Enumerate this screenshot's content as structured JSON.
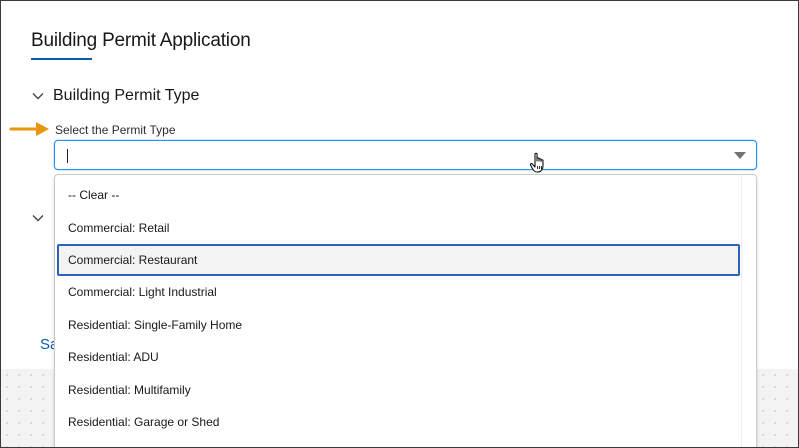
{
  "app": {
    "title": "Building Permit Application"
  },
  "sections": [
    {
      "label": "Building Permit Type",
      "expanded": true
    },
    {
      "label": "",
      "expanded": false
    }
  ],
  "field": {
    "label": "Select the Permit Type",
    "value": "",
    "placeholder": ""
  },
  "dropdown": {
    "options": [
      "-- Clear --",
      "Commercial: Retail",
      "Commercial: Restaurant",
      "Commercial: Light Industrial",
      "Residential: Single-Family Home",
      "Residential: ADU",
      "Residential: Multifamily",
      "Residential: Garage or Shed"
    ],
    "highlighted_index": 2
  },
  "footer": {
    "save_partial": "Sa"
  },
  "colors": {
    "accent": "#0b5cab",
    "focus_border": "#1b96ff",
    "highlight_border": "#2a63b8",
    "arrow": "#e8960c"
  },
  "icons": {
    "section_toggle": "chevron-down-icon",
    "combo_toggle": "triangle-down-icon",
    "pointer": "arrow-right-icon",
    "cursor": "hand-cursor-icon"
  }
}
